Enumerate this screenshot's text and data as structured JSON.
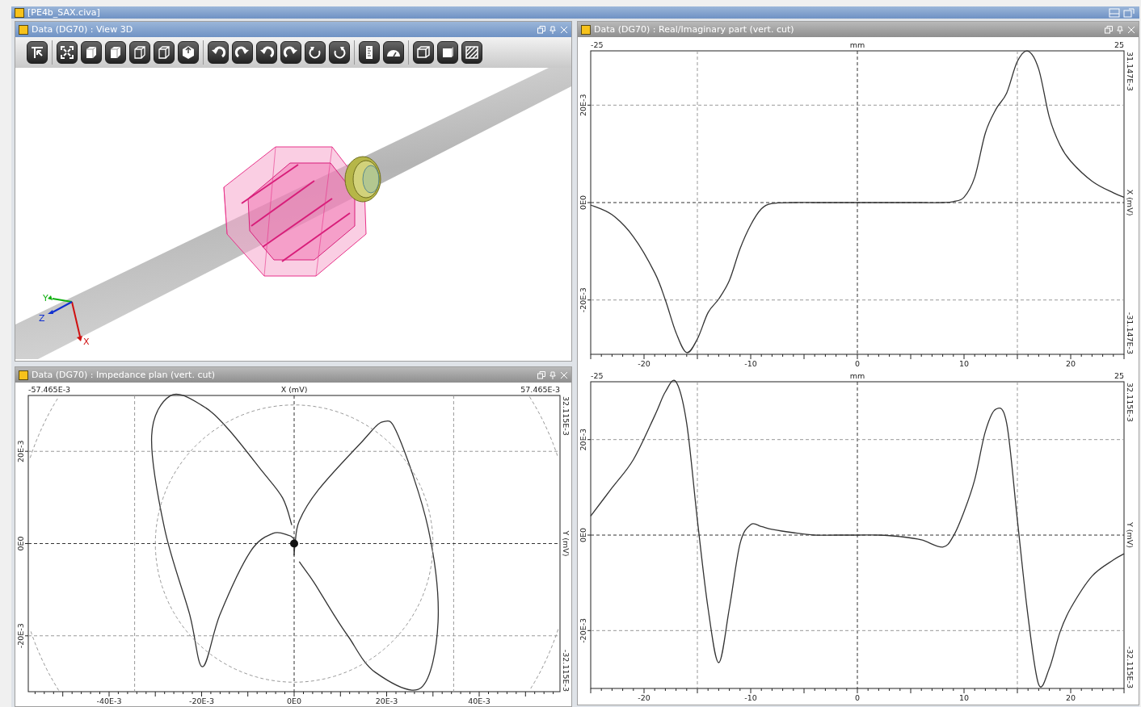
{
  "window": {
    "title": "[PE4b_SAX.civa]"
  },
  "view_3d": {
    "title": "Data (DG70) : View 3D",
    "axis_labels": [
      "X",
      "Y",
      "Z"
    ]
  },
  "impedance_plan": {
    "title": "Data (DG70) : Impedance plan (vert. cut)",
    "range_labels": {
      "x_min": "-57.465E-3",
      "x_max": "57.465E-3",
      "y_max": "32.115E-3",
      "y_min": "-32.115E-3"
    },
    "chart_data": {
      "type": "line",
      "grid": true,
      "xlabel": "X (mV)",
      "ylabel": "Y (mV)",
      "xlim": [
        -0.057465,
        0.057465
      ],
      "ylim": [
        -0.032115,
        0.032115
      ],
      "xticks": [
        {
          "value": -0.04,
          "label": "-40E-3"
        },
        {
          "value": -0.02,
          "label": "-20E-3"
        },
        {
          "value": 0,
          "label": "0E0"
        },
        {
          "value": 0.02,
          "label": "20E-3"
        },
        {
          "value": 0.04,
          "label": "40E-3"
        }
      ],
      "yticks": [
        {
          "value": 0.02,
          "label": "20E-3"
        },
        {
          "value": 0,
          "label": "0E0"
        },
        {
          "value": -0.02,
          "label": "-20E-3"
        }
      ],
      "x": [
        -0.0005,
        -0.0025,
        -0.007,
        -0.0144,
        -0.02,
        -0.0267,
        -0.0308,
        -0.028,
        -0.0226,
        -0.0198,
        -0.016,
        -0.0095,
        -0.0046,
        -0.0013,
        -0.0002,
        0,
        0,
        0,
        0,
        0,
        0,
        0,
        0,
        0.0002,
        0.0011,
        0.0052,
        0.0143,
        0.0192,
        0.0225,
        0.029,
        0.0311,
        0.0274,
        0.0175,
        0.0118,
        0.0085,
        0.0044,
        0.002,
        0.0011
      ],
      "series": [
        {
          "values": [
            0.004,
            0.0099,
            0.0158,
            0.025,
            0.03,
            0.0321,
            0.0234,
            0.0032,
            -0.0153,
            -0.0267,
            -0.0153,
            -0.0018,
            0.0022,
            0.0018,
            0.0012,
            0.0005,
            0,
            0,
            0,
            0,
            -0.0003,
            -0.001,
            -0.0025,
            -0.0002,
            0.0049,
            0.0116,
            0.0217,
            0.0264,
            0.0234,
            0.0032,
            -0.017,
            -0.0313,
            -0.0279,
            -0.0203,
            -0.0153,
            -0.0086,
            -0.0052,
            -0.0039
          ]
        }
      ]
    }
  },
  "real_imaginary": {
    "title": "Data (DG70) : Real/Imaginary part (vert. cut)",
    "charts": [
      {
        "range_labels": {
          "x_min": "-25",
          "x_max": "25",
          "y_max": "31.147E-3",
          "y_min": "-31.147E-3"
        },
        "chart_data": {
          "type": "line",
          "grid": true,
          "xlabel": "mm",
          "ylabel": "X (mV)",
          "xlim": [
            -25,
            25
          ],
          "ylim": [
            -0.031147,
            0.031147
          ],
          "xticks": [
            -20,
            -10,
            0,
            10,
            20
          ],
          "yticks": [
            {
              "value": 0.02,
              "label": "20E-3"
            },
            {
              "value": 0,
              "label": "0E0"
            },
            {
              "value": -0.02,
              "label": "-20E-3"
            }
          ],
          "x": [
            -25,
            -23,
            -21,
            -19,
            -18,
            -17,
            -16,
            -15,
            -14,
            -13,
            -12,
            -11,
            -10,
            -9,
            -8,
            -6,
            -4,
            -2,
            0,
            2,
            4,
            6,
            8,
            9,
            10,
            11,
            12,
            13,
            14,
            15,
            16,
            17,
            18,
            19,
            20,
            22,
            24,
            25
          ],
          "series": [
            {
              "values": [
                -0.0005,
                -0.0025,
                -0.007,
                -0.0144,
                -0.02,
                -0.0267,
                -0.0308,
                -0.028,
                -0.0226,
                -0.0198,
                -0.016,
                -0.0095,
                -0.0046,
                -0.0013,
                -0.0002,
                0,
                0,
                0,
                0,
                0,
                0,
                0,
                0,
                0.0002,
                0.0011,
                0.0052,
                0.0143,
                0.0192,
                0.0225,
                0.029,
                0.0311,
                0.0274,
                0.0175,
                0.0118,
                0.0085,
                0.0044,
                0.002,
                0.0011
              ]
            }
          ]
        }
      },
      {
        "range_labels": {
          "x_min": "-25",
          "x_max": "25",
          "y_max": "32.115E-3",
          "y_min": "-32.115E-3"
        },
        "chart_data": {
          "type": "line",
          "grid": true,
          "xlabel": "mm",
          "ylabel": "Y (mV)",
          "xlim": [
            -25,
            25
          ],
          "ylim": [
            -0.032115,
            0.032115
          ],
          "xticks": [
            -20,
            -10,
            0,
            10,
            20
          ],
          "yticks": [
            {
              "value": 0.02,
              "label": "20E-3"
            },
            {
              "value": 0,
              "label": "0E0"
            },
            {
              "value": -0.02,
              "label": "-20E-3"
            }
          ],
          "x": [
            -25,
            -23,
            -21,
            -19,
            -18,
            -17,
            -16,
            -15,
            -14,
            -13,
            -12,
            -11,
            -10,
            -9,
            -8,
            -6,
            -4,
            -2,
            0,
            2,
            4,
            6,
            8,
            9,
            10,
            11,
            12,
            13,
            14,
            15,
            16,
            17,
            18,
            19,
            20,
            22,
            24,
            25
          ],
          "series": [
            {
              "values": [
                0.004,
                0.0099,
                0.0158,
                0.025,
                0.03,
                0.0321,
                0.0234,
                0.0032,
                -0.0153,
                -0.0267,
                -0.0153,
                -0.0018,
                0.0022,
                0.0018,
                0.0012,
                0.0005,
                0,
                0,
                0,
                0,
                -0.0003,
                -0.001,
                -0.0025,
                -0.0002,
                0.0049,
                0.0116,
                0.0217,
                0.0264,
                0.0234,
                0.0032,
                -0.017,
                -0.0313,
                -0.0279,
                -0.0203,
                -0.0153,
                -0.0086,
                -0.0052,
                -0.0039
              ]
            }
          ]
        }
      }
    ]
  }
}
